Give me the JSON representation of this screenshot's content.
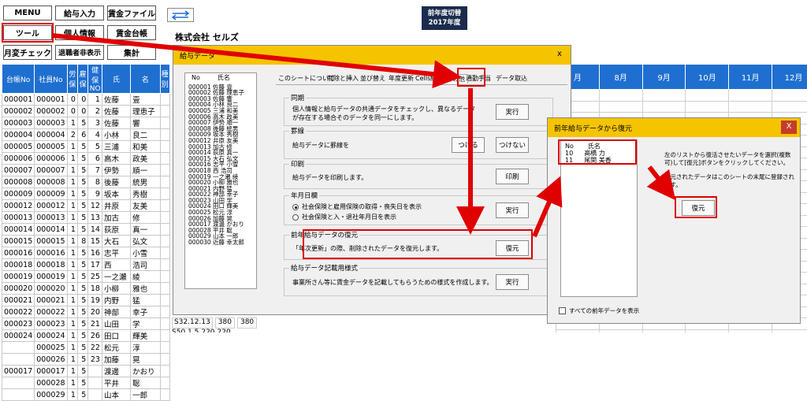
{
  "toolbar": {
    "menu": "MENU",
    "salary_input": "給与入力",
    "wage_file": "賃金ファイル",
    "tools": "ツール",
    "personal_info": "個人情報",
    "wage_ledger": "賃金台帳",
    "monthly_check": "月変チェック",
    "retiree_toggle": "退職者非表示",
    "summary": "集計"
  },
  "badge": {
    "line1": "前年度切替",
    "line2": "2017年度"
  },
  "company": "株式会社 セルズ",
  "sheet": {
    "headers": [
      "台帳No",
      "社員No",
      "労保",
      "雇保",
      "健保NO",
      "氏",
      "名",
      "種別"
    ],
    "rows": [
      [
        "000001",
        "000001",
        "0",
        "0",
        "1",
        "佐藤",
        "壹"
      ],
      [
        "000002",
        "000002",
        "0",
        "0",
        "2",
        "佐藤",
        "理恵子"
      ],
      [
        "000003",
        "000003",
        "1",
        "5",
        "3",
        "佐藤",
        "響"
      ],
      [
        "000004",
        "000004",
        "2",
        "6",
        "4",
        "小林",
        "良二"
      ],
      [
        "000005",
        "000005",
        "1",
        "5",
        "5",
        "三浦",
        "和美"
      ],
      [
        "000006",
        "000006",
        "1",
        "5",
        "6",
        "高木",
        "政美"
      ],
      [
        "000007",
        "000007",
        "1",
        "5",
        "7",
        "伊勢",
        "順一"
      ],
      [
        "000008",
        "000008",
        "1",
        "5",
        "8",
        "後藤",
        "統男"
      ],
      [
        "000009",
        "000009",
        "1",
        "5",
        "9",
        "坂本",
        "秀樹"
      ],
      [
        "000012",
        "000012",
        "1",
        "5",
        "12",
        "井原",
        "友美"
      ],
      [
        "000013",
        "000013",
        "1",
        "5",
        "13",
        "加古",
        "修"
      ],
      [
        "000014",
        "000014",
        "1",
        "5",
        "14",
        "荻原",
        "真一"
      ],
      [
        "000015",
        "000015",
        "1",
        "8",
        "15",
        "大石",
        "弘文"
      ],
      [
        "000016",
        "000016",
        "1",
        "5",
        "16",
        "志平",
        "小雪"
      ],
      [
        "000018",
        "000018",
        "1",
        "5",
        "17",
        "西",
        "浩司"
      ],
      [
        "000019",
        "000019",
        "1",
        "5",
        "25",
        "一之瀬",
        "綾"
      ],
      [
        "000020",
        "000020",
        "1",
        "5",
        "18",
        "小柳",
        "雅也"
      ],
      [
        "000021",
        "000021",
        "1",
        "5",
        "19",
        "内野",
        "猛"
      ],
      [
        "000022",
        "000022",
        "1",
        "5",
        "20",
        "神部",
        "幸子"
      ],
      [
        "000023",
        "000023",
        "1",
        "5",
        "21",
        "山田",
        "学"
      ],
      [
        "000024",
        "000024",
        "1",
        "5",
        "26",
        "田口",
        "輝美"
      ],
      [
        "",
        "000025",
        "1",
        "5",
        "22",
        "松元",
        "淳"
      ],
      [
        "",
        "000026",
        "1",
        "5",
        "23",
        "加藤",
        "晃"
      ],
      [
        "000017",
        "000017",
        "1",
        "5",
        "",
        "渡邊",
        "かおり"
      ],
      [
        "",
        "000028",
        "1",
        "5",
        "",
        "平井",
        "聡"
      ],
      [
        "",
        "000029",
        "1",
        "5",
        "",
        "山本",
        "一郎"
      ]
    ],
    "extra_row": {
      "date": "S32.12.13",
      "v1": "380",
      "v2": "380"
    },
    "extra_row2": {
      "date": "S50.1.5",
      "v1": "220",
      "v2": "220"
    }
  },
  "months": [
    "8月",
    "9月",
    "10月",
    "11月",
    "12月"
  ],
  "month_label_partial": "月",
  "dialog1": {
    "title": "給与データ",
    "list_header_no": "No",
    "list_header_name": "氏名",
    "list_items": [
      "000001 佐藤 壹",
      "000002 佐藤 理恵子",
      "000003 佐藤 響",
      "000004 小林 良二",
      "000005 三浦 和美",
      "000006 高木 政美",
      "000007 伊勢 順一",
      "000008 後藤 統男",
      "000009 坂本 秀樹",
      "000012 井原 友美",
      "000013 加古 修",
      "000014 荻原 真一",
      "000015 大石 弘文",
      "000016 志平 小雪",
      "000018 西 浩司",
      "000019 一之瀬 綾",
      "000020 小柳 雅也",
      "000021 内野 猛",
      "000022 神部 幸子",
      "000023 山田 学",
      "000024 田口 輝美",
      "000025 松元 淳",
      "000026 加藤 晃",
      "000017 渡邊 かおり",
      "000028 平井 聡",
      "000029 山本 一郎",
      "000030 近藤 幸太郎"
    ],
    "tabs": [
      "このシートについて",
      "削除と挿入",
      "並び替え",
      "年度更新",
      "Cells給与",
      "その他",
      "通勤手当",
      "データ取込"
    ],
    "groups": {
      "sync": {
        "label": "同期",
        "desc1": "個人情報と給与データの共通データをチェックし、異なるデータ",
        "desc2": "が存在する場合そのデータを同一にします。",
        "btn": "実行"
      },
      "border": {
        "label": "罫線",
        "desc": "給与データに罫線を",
        "btn1": "つける",
        "btn2": "つけない"
      },
      "print": {
        "label": "印刷",
        "desc": "給与データを印刷します。",
        "btn": "印刷"
      },
      "date": {
        "label": "年月日欄",
        "opt1": "社会保険と雇用保険の取得・喪失日を表示",
        "opt2": "社会保険と入・退社年月日を表示",
        "btn": "実行"
      },
      "restore": {
        "label": "前年給与データの復元",
        "desc": "「年次更新」の際、削除されたデータを復元します。",
        "btn": "復元"
      },
      "template": {
        "label": "給与データ記載用様式",
        "desc": "事業所さん等に賃金データを記載してもらうための様式を作成します。",
        "btn": "実行"
      }
    }
  },
  "dialog2": {
    "title": "前年給与データから復元",
    "header_no": "No",
    "header_name": "氏名",
    "items": [
      {
        "no": "10",
        "name": "高橋 力"
      },
      {
        "no": "11",
        "name": "尾関 美香"
      }
    ],
    "desc1": "左のリストから復活させたいデータを選択(複数",
    "desc2": "可)して[復元]ボタンをクリックしてください。",
    "desc3": "復元されたデータはこのシートの末尾に登録され",
    "desc4": "ます。",
    "restore_btn": "復元",
    "show_all": "すべての前年データを表示"
  },
  "close_glyph": "x",
  "close_glyph2": "X",
  "colors": {
    "accent_red": "#e00000",
    "header_blue": "#1f6fd0",
    "dialog_yellow": "#f5c400"
  }
}
